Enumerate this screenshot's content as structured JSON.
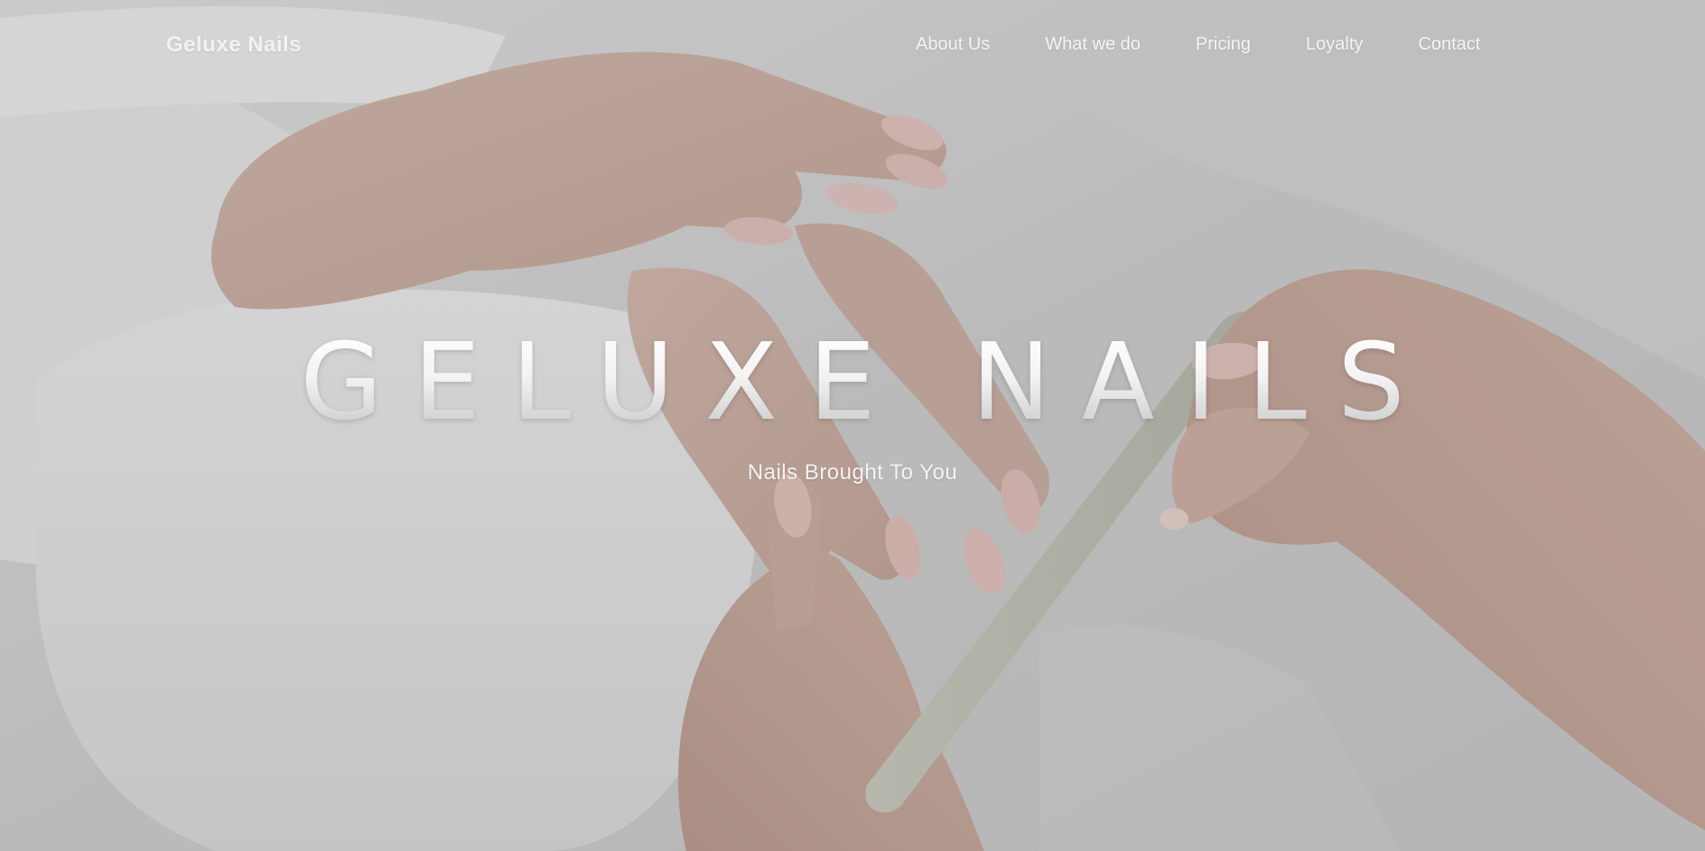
{
  "brand": {
    "name": "Geluxe Nails"
  },
  "nav": {
    "links": [
      {
        "label": "About Us"
      },
      {
        "label": "What we do"
      },
      {
        "label": "Pricing"
      },
      {
        "label": "Loyalty"
      },
      {
        "label": "Contact"
      }
    ]
  },
  "hero": {
    "title": "GELUXE NAILS",
    "subtitle": "Nails Brought To You"
  },
  "colors": {
    "nav_text": "#f4f4f4",
    "background_tint": "#c9c9c9",
    "title_text": "#ffffff"
  }
}
